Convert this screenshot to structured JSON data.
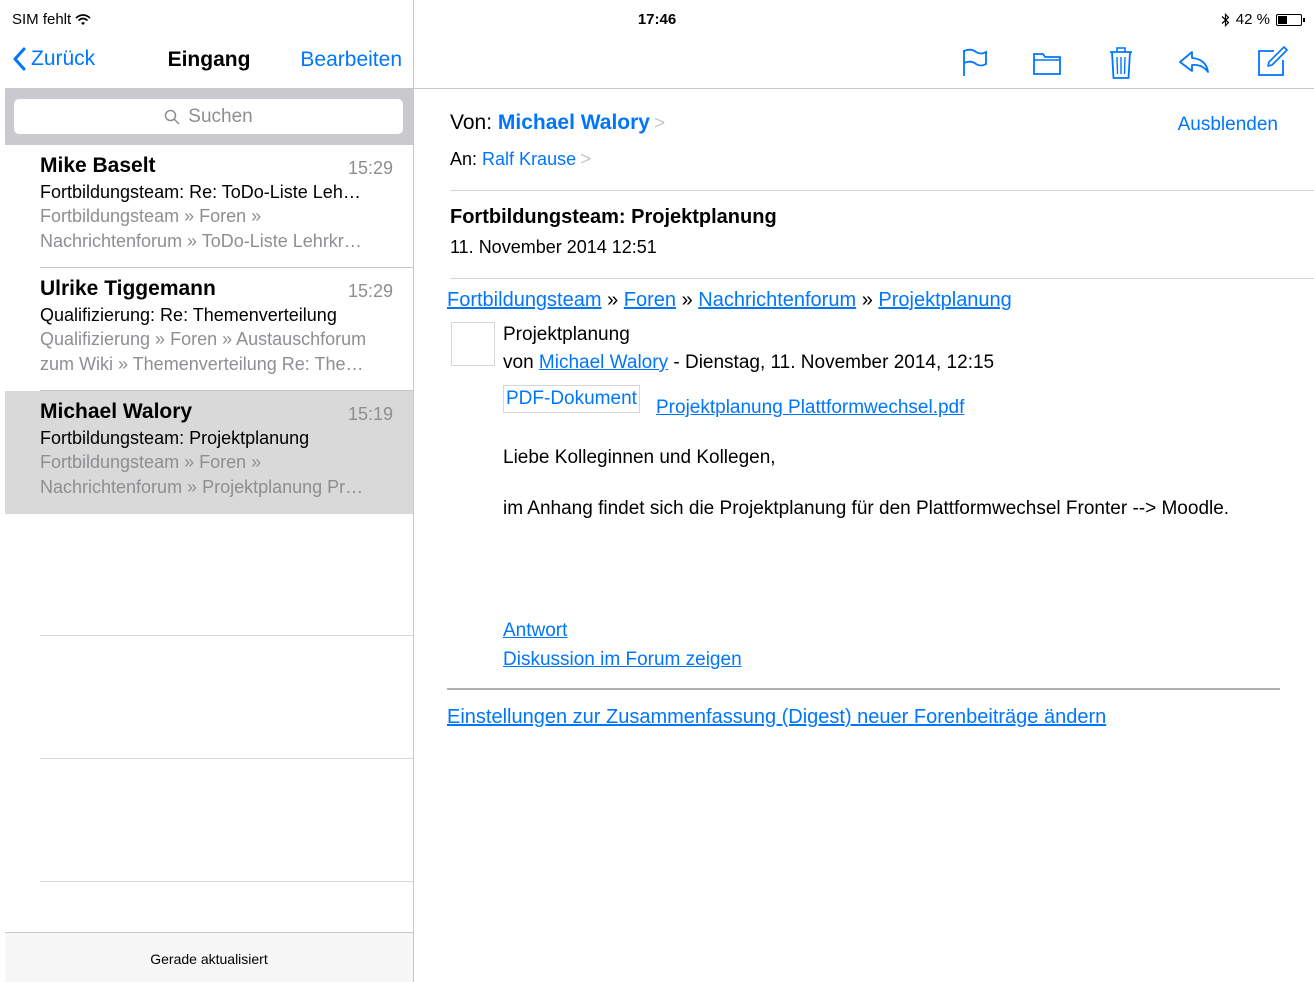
{
  "status": {
    "carrier": "SIM fehlt",
    "time": "17:46",
    "battery_text": "42 %",
    "battery_level": 0.42
  },
  "nav": {
    "back_label": "Zurück",
    "title": "Eingang",
    "edit_label": "Bearbeiten"
  },
  "search": {
    "placeholder": "Suchen"
  },
  "mails": [
    {
      "sender": "Mike Baselt",
      "time": "15:29",
      "subject": "Fortbildungsteam: Re: ToDo-Liste Leh…",
      "preview1": "Fortbildungsteam » Foren »",
      "preview2": "Nachrichtenforum » ToDo-Liste Lehrkr…"
    },
    {
      "sender": "Ulrike Tiggemann",
      "time": "15:29",
      "subject": "Qualifizierung: Re: Themenverteilung",
      "preview1": "Qualifizierung » Foren » Austauschforum",
      "preview2": "zum Wiki » Themenverteilung Re: The…"
    },
    {
      "sender": "Michael Walory",
      "time": "15:19",
      "subject": "Fortbildungsteam: Projektplanung",
      "preview1": "Fortbildungsteam » Foren »",
      "preview2": "Nachrichtenforum » Projektplanung Pr…"
    }
  ],
  "bottom_status": "Gerade aktualisiert",
  "message": {
    "from_label": "Von:",
    "from_name": "Michael Walory",
    "to_label": "An:",
    "to_name": "Ralf Krause",
    "hide_label": "Ausblenden",
    "subject": "Fortbildungsteam: Projektplanung",
    "date": "11. November 2014 12:51"
  },
  "body": {
    "crumb1": "Fortbildungsteam",
    "crumb2": "Foren",
    "crumb3": "Nachrichtenforum",
    "crumb4": "Projektplanung",
    "crumb_sep": "»",
    "post_title": "Projektplanung",
    "by_prefix": "von",
    "by_name": "Michael Walory",
    "by_date": "- Dienstag, 11. November 2014, 12:15",
    "pdf_label": "PDF-Dokument",
    "pdf_link": "Projektplanung Plattformwechsel.pdf",
    "greeting": "Liebe Kolleginnen und Kollegen,",
    "paragraph": "im Anhang findet sich die Projektplanung für den Plattformwechsel Fronter --> Moodle.",
    "reply_link": "Antwort",
    "discussion_link": "Diskussion im Forum zeigen",
    "digest_link": "Einstellungen zur Zusammenfassung (Digest) neuer Forenbeiträge ändern"
  },
  "colors": {
    "accent": "#0076ff",
    "selected_row": "#d9d9d9",
    "search_bg": "#c9c9ce"
  },
  "icons": [
    "wifi-icon",
    "bluetooth-icon",
    "battery-icon",
    "back-chevron-icon",
    "search-icon",
    "flag-icon",
    "folder-icon",
    "trash-icon",
    "reply-icon",
    "compose-icon"
  ]
}
